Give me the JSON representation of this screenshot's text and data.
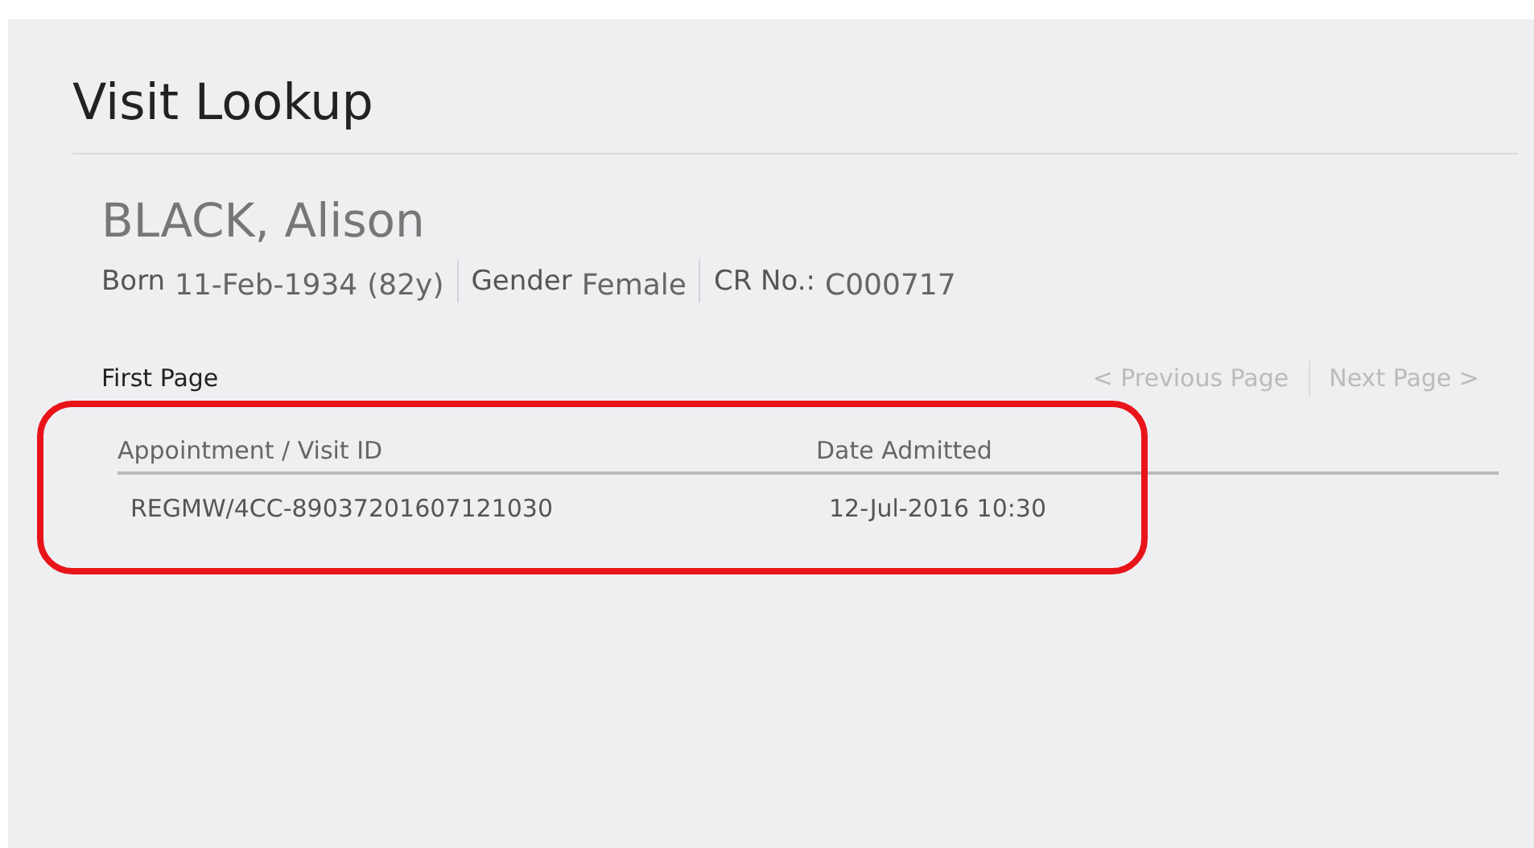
{
  "page": {
    "title": "Visit Lookup"
  },
  "patient": {
    "name": "BLACK, Alison",
    "details": [
      {
        "label": "Born",
        "value": "11-Feb-1934",
        "extra": "(82y)"
      },
      {
        "label": "Gender",
        "value": "Female"
      },
      {
        "label": "CR No.:",
        "value": "C000717"
      }
    ]
  },
  "pager": {
    "current": "First Page",
    "links": [
      {
        "label": "< Previous Page",
        "disabled": true
      },
      {
        "label": "Next Page >",
        "disabled": true
      }
    ]
  },
  "table": {
    "columns": [
      "Appointment / Visit ID",
      "Date Admitted"
    ],
    "rows": [
      [
        "REGMW/4CC-89037201607121030",
        "12-Jul-2016 10:30"
      ]
    ]
  }
}
